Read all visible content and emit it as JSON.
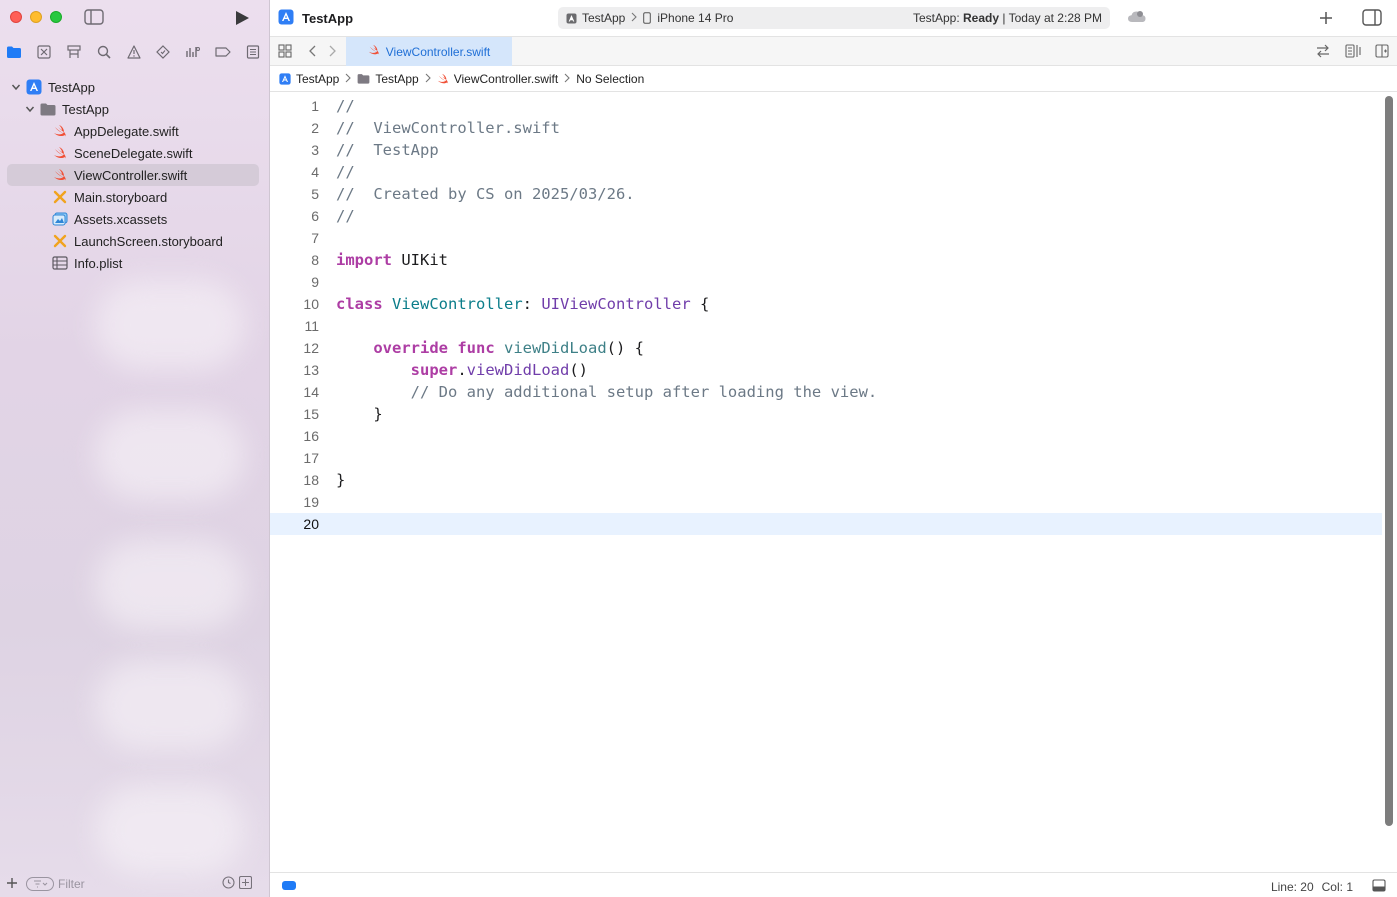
{
  "window": {
    "title": "TestApp"
  },
  "toolbar": {
    "scheme": "TestApp",
    "device": "iPhone 14 Pro",
    "status_prefix": "TestApp:",
    "status_state": "Ready",
    "status_time": "| Today at 2:28 PM"
  },
  "sidebar": {
    "filter_placeholder": "Filter",
    "tree": [
      {
        "label": "TestApp",
        "icon": "xcode-project-icon",
        "level": 0,
        "expanded": true
      },
      {
        "label": "TestApp",
        "icon": "folder-icon",
        "level": 1,
        "expanded": true
      },
      {
        "label": "AppDelegate.swift",
        "icon": "swift-file-icon",
        "level": 2
      },
      {
        "label": "SceneDelegate.swift",
        "icon": "swift-file-icon",
        "level": 2
      },
      {
        "label": "ViewController.swift",
        "icon": "swift-file-icon",
        "level": 2,
        "selected": true
      },
      {
        "label": "Main.storyboard",
        "icon": "storyboard-icon",
        "level": 2
      },
      {
        "label": "Assets.xcassets",
        "icon": "asset-catalog-icon",
        "level": 2
      },
      {
        "label": "LaunchScreen.storyboard",
        "icon": "storyboard-icon",
        "level": 2
      },
      {
        "label": "Info.plist",
        "icon": "plist-icon",
        "level": 2
      }
    ]
  },
  "tabs": {
    "active": "ViewController.swift"
  },
  "jumpbar": {
    "project": "TestApp",
    "group": "TestApp",
    "file": "ViewController.swift",
    "selection": "No Selection"
  },
  "editor": {
    "line_numbers": [
      "1",
      "2",
      "3",
      "4",
      "5",
      "6",
      "7",
      "8",
      "9",
      "10",
      "11",
      "12",
      "13",
      "14",
      "15",
      "16",
      "17",
      "18",
      "19",
      "20"
    ],
    "current_line": "20"
  },
  "statusbar": {
    "line": "Line: 20",
    "col": "Col: 1"
  },
  "colors": {
    "accent": "#1f7bf6",
    "keyword": "#ad3da4",
    "comment": "#6c7986",
    "type": "#703daa",
    "swift_orange": "#f05138"
  }
}
